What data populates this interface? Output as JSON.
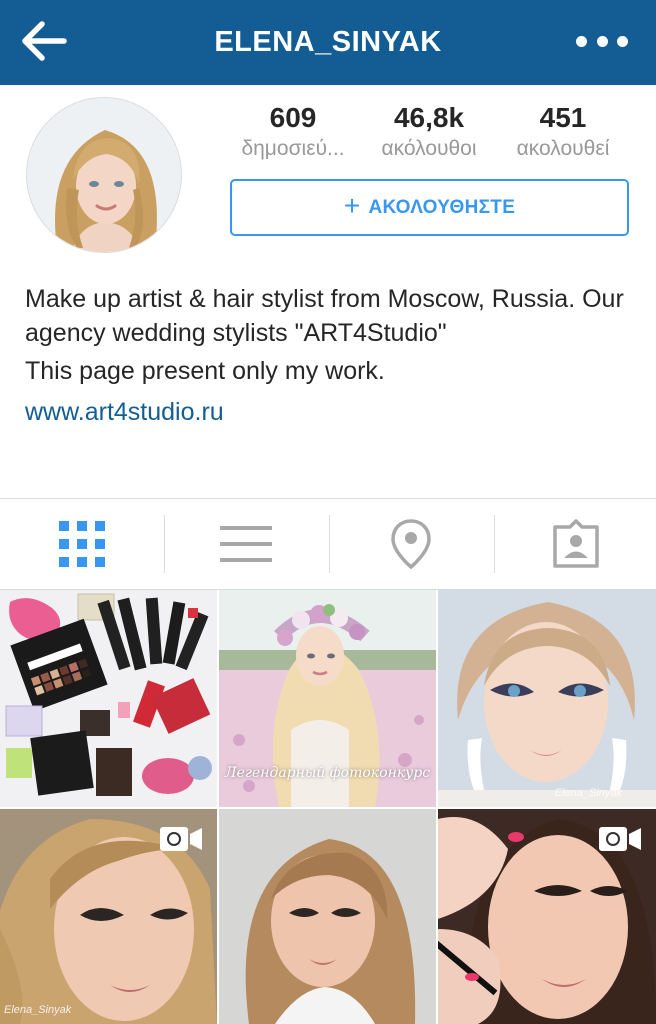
{
  "header": {
    "title": "ELENA_SINYAK",
    "back_icon": "arrow-left-icon",
    "more_icon": "more-horizontal-icon",
    "background_color": "#135D94"
  },
  "profile": {
    "avatar_alt": "profile-avatar",
    "stats": [
      {
        "value": "609",
        "label": "δημοσιεύ..."
      },
      {
        "value": "46,8k",
        "label": "ακόλουθοι"
      },
      {
        "value": "451",
        "label": "ακολουθεί"
      }
    ],
    "follow_button": {
      "icon": "+",
      "label": "ΑΚΟΛΟΥΘΗΣΤΕ",
      "accent_color": "#3897f0"
    }
  },
  "bio": {
    "line1": "Make up artist & hair stylist from Moscow, Russia. Our agency wedding stylists \"ART4Studio\"",
    "line2": "This page present only my work.",
    "link": "www.art4studio.ru",
    "link_color": "#135D94"
  },
  "tabs": [
    {
      "icon": "grid-icon",
      "active": true
    },
    {
      "icon": "list-icon",
      "active": false
    },
    {
      "icon": "location-pin-icon",
      "active": false
    },
    {
      "icon": "tagged-user-icon",
      "active": false
    }
  ],
  "posts": [
    {
      "type": "photo",
      "subject": "cosmetics flatlay"
    },
    {
      "type": "photo",
      "subject": "bride with flower crown",
      "caption": "Легендарный фотоконкурс"
    },
    {
      "type": "photo",
      "subject": "makeup portrait",
      "watermark": "Elena_Sinyak"
    },
    {
      "type": "video",
      "subject": "makeup portrait",
      "watermark": "Elena_Sinyak"
    },
    {
      "type": "photo",
      "subject": "hairstyle portrait"
    },
    {
      "type": "video",
      "subject": "eyeliner application"
    }
  ]
}
